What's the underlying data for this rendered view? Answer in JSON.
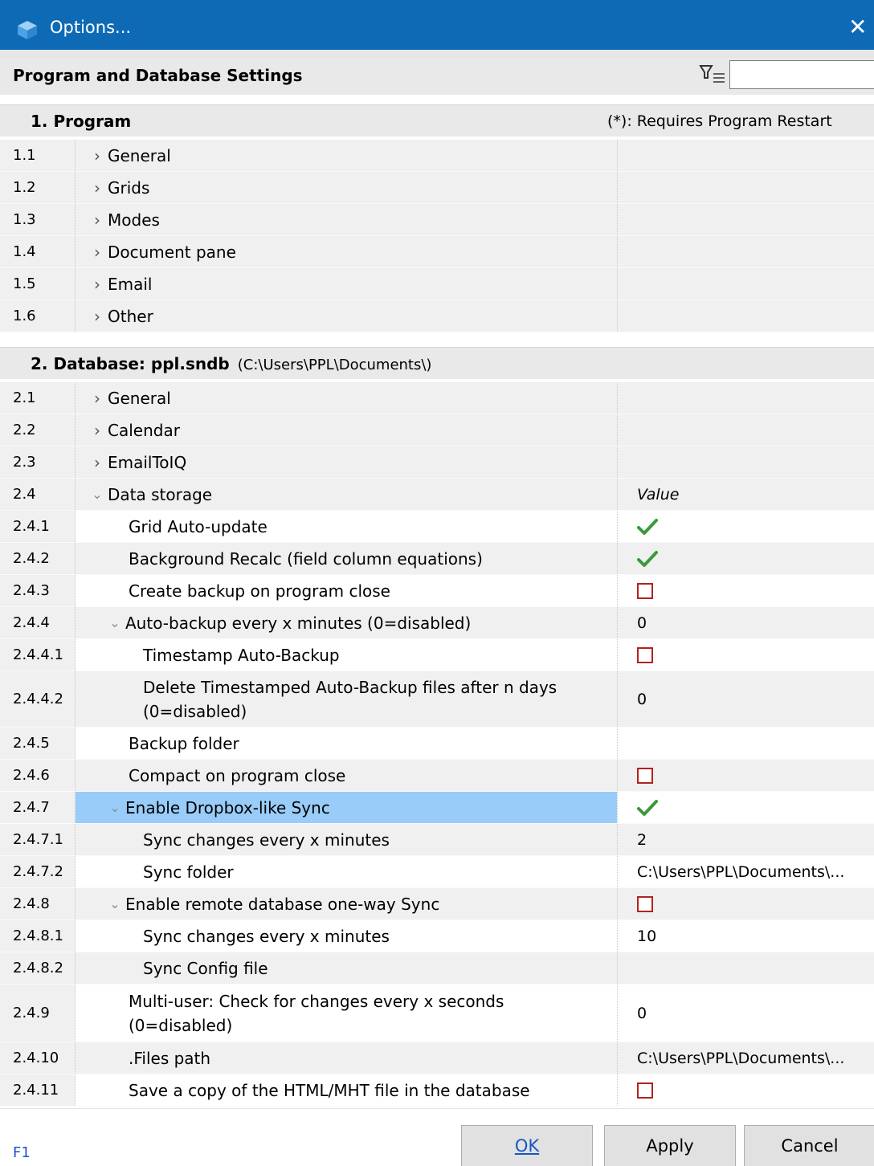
{
  "window": {
    "title": "Options...",
    "close_glyph": "✕",
    "icon": "cube-icon"
  },
  "header": {
    "title": "Program and Database Settings",
    "filter_icon": "filter-icon",
    "filter_value": ""
  },
  "section1": {
    "number": "1.",
    "title": "Program",
    "note": "(*): Requires Program Restart"
  },
  "program_rows": [
    {
      "num": "1.1",
      "label": "General"
    },
    {
      "num": "1.2",
      "label": "Grids"
    },
    {
      "num": "1.3",
      "label": "Modes"
    },
    {
      "num": "1.4",
      "label": "Document pane"
    },
    {
      "num": "1.5",
      "label": "Email"
    },
    {
      "num": "1.6",
      "label": "Other"
    }
  ],
  "section2": {
    "number": "2.",
    "title": "Database: ppl.sndb",
    "path": "(C:\\Users\\PPL\\Documents\\)"
  },
  "db_rows": [
    {
      "num": "2.1",
      "label": "General"
    },
    {
      "num": "2.2",
      "label": "Calendar"
    },
    {
      "num": "2.3",
      "label": "EmailToIQ"
    },
    {
      "num": "2.4",
      "label": "Data storage",
      "value_header": "Value"
    }
  ],
  "storage_rows": [
    {
      "num": "2.4.1",
      "label": "Grid Auto-update",
      "value_type": "checked"
    },
    {
      "num": "2.4.2",
      "label": "Background Recalc (field column equations)",
      "value_type": "checked"
    },
    {
      "num": "2.4.3",
      "label": "Create backup on program close",
      "value_type": "unchecked"
    },
    {
      "num": "2.4.4",
      "label": "Auto-backup every x minutes (0=disabled)",
      "value": "0"
    },
    {
      "num": "2.4.4.1",
      "label": "Timestamp Auto-Backup",
      "value_type": "unchecked"
    },
    {
      "num": "2.4.4.2",
      "label_line1": "Delete Timestamped Auto-Backup files after n days",
      "label_line2": "(0=disabled)",
      "value": "0"
    },
    {
      "num": "2.4.5",
      "label": "Backup folder",
      "value": ""
    },
    {
      "num": "2.4.6",
      "label": "Compact on program close",
      "value_type": "unchecked"
    },
    {
      "num": "2.4.7",
      "label": "Enable Dropbox-like Sync",
      "value_type": "checked",
      "selected": true
    },
    {
      "num": "2.4.7.1",
      "label": "Sync changes every x minutes",
      "value": "2"
    },
    {
      "num": "2.4.7.2",
      "label": "Sync folder",
      "value": "C:\\Users\\PPL\\Documents\\..."
    },
    {
      "num": "2.4.8",
      "label": "Enable remote database one-way Sync",
      "value_type": "unchecked"
    },
    {
      "num": "2.4.8.1",
      "label": "Sync changes every x minutes",
      "value": "10"
    },
    {
      "num": "2.4.8.2",
      "label": "Sync Config file",
      "value": ""
    },
    {
      "num": "2.4.9",
      "label_line1": "Multi-user: Check for changes every x seconds",
      "label_line2": "(0=disabled)",
      "value": "0"
    },
    {
      "num": "2.4.10",
      "label": ".Files path",
      "value": "C:\\Users\\PPL\\Documents\\..."
    },
    {
      "num": "2.4.11",
      "label": "Save a copy of the HTML/MHT file in the database",
      "value_type": "unchecked"
    }
  ],
  "footer": {
    "help": "F1",
    "ok": "OK",
    "apply": "Apply",
    "cancel": "Cancel"
  },
  "colors": {
    "titlebar": "#0f6ab5",
    "selection": "#99ccf8",
    "check_green": "#3a9a3a",
    "checkbox_red": "#b22222",
    "link_blue": "#1a55c4"
  }
}
